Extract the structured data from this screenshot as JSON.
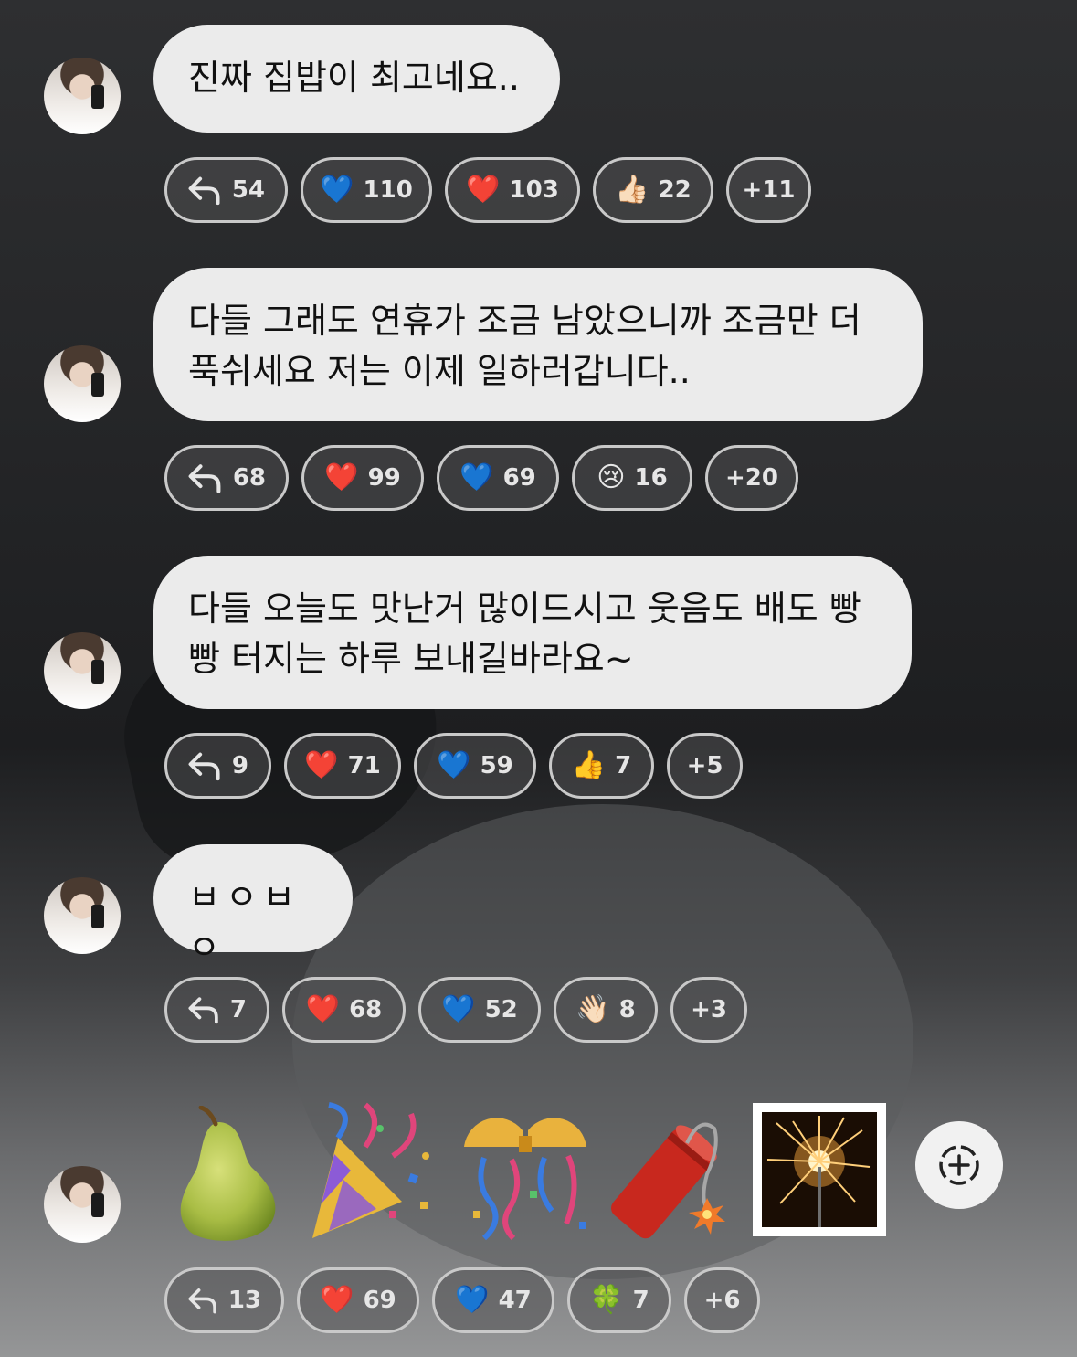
{
  "messages": [
    {
      "text": "진짜 집밥이 최고네요..",
      "reactions": [
        {
          "icon": "reply-icon",
          "label": "54"
        },
        {
          "icon": "💙",
          "label": "110"
        },
        {
          "icon": "❤️",
          "label": "103"
        },
        {
          "icon": "👍🏻",
          "label": "22"
        },
        {
          "icon": "",
          "label": "+11"
        }
      ]
    },
    {
      "text": "다들 그래도 연휴가 조금 남았으니까 조금만 더\n푹쉬세요 저는 이제 일하러갑니다..",
      "reactions": [
        {
          "icon": "reply-icon",
          "label": "68"
        },
        {
          "icon": "❤️",
          "label": "99"
        },
        {
          "icon": "💙",
          "label": "69"
        },
        {
          "icon": "😢",
          "label": "16"
        },
        {
          "icon": "",
          "label": "+20"
        }
      ]
    },
    {
      "text": "다들 오늘도 맛난거 많이드시고 웃음도 배도 빵\n빵 터지는 하루 보내길바라요~",
      "reactions": [
        {
          "icon": "reply-icon",
          "label": "9"
        },
        {
          "icon": "❤️",
          "label": "71"
        },
        {
          "icon": "💙",
          "label": "59"
        },
        {
          "icon": "👍",
          "label": "7"
        },
        {
          "icon": "",
          "label": "+5"
        }
      ]
    },
    {
      "text": "ㅂㅇㅂㅇ",
      "reactions": [
        {
          "icon": "reply-icon",
          "label": "7"
        },
        {
          "icon": "❤️",
          "label": "68"
        },
        {
          "icon": "💙",
          "label": "52"
        },
        {
          "icon": "👋🏻",
          "label": "8"
        },
        {
          "icon": "",
          "label": "+3"
        }
      ]
    },
    {
      "stickers": [
        "🍐",
        "🎉",
        "🎊",
        "🧨",
        "🎇"
      ],
      "reactions": [
        {
          "icon": "reply-icon",
          "label": "13"
        },
        {
          "icon": "❤️",
          "label": "69"
        },
        {
          "icon": "💙",
          "label": "47"
        },
        {
          "icon": "🍀",
          "label": "7"
        },
        {
          "icon": "",
          "label": "+6"
        }
      ]
    }
  ],
  "add_reaction_icon": "add-reaction-icon"
}
